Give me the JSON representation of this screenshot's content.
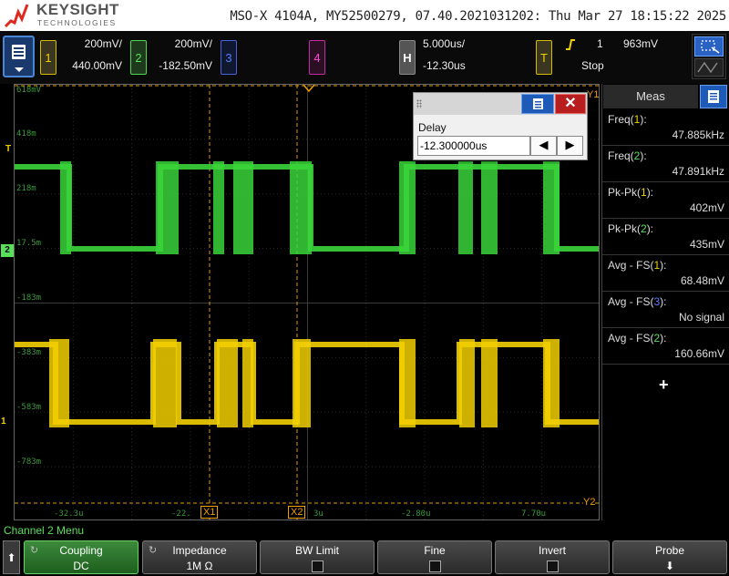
{
  "header": {
    "brand": "KEYSIGHT",
    "brand_sub": "TECHNOLOGIES",
    "title": "MSO-X 4104A, MY52500279, 07.40.2021031202: Thu Mar 27 18:15:22 2025"
  },
  "channels": [
    {
      "num": "1",
      "scale": "200mV/",
      "offset": "440.00mV",
      "color": "#f2d000"
    },
    {
      "num": "2",
      "scale": "200mV/",
      "offset": "-182.50mV",
      "color": "#58e058"
    },
    {
      "num": "3",
      "color": "#5b7cff"
    },
    {
      "num": "4",
      "color": "#ff4ad8"
    }
  ],
  "horizontal": {
    "tag": "H",
    "timebase": "5.000us/",
    "delay": "-12.30us"
  },
  "trigger": {
    "tag": "T",
    "edge_icon": "rising-edge-icon",
    "source": "1",
    "level": "963mV",
    "status": "Stop"
  },
  "graticule": {
    "y_labels": [
      "618mV",
      "418m",
      "218m",
      "17.5m",
      "-183m",
      "-383m",
      "-583m",
      "-783m"
    ],
    "x_labels": [
      "-32.3u",
      "-22.",
      "3u",
      "-2.80u",
      "7.70u"
    ],
    "markers": {
      "trigger_left": "T",
      "ch2": "2",
      "ch1": "1",
      "cursor_x1": "X1",
      "cursor_x2": "X2",
      "cursor_y1": "Y1",
      "cursor_y2": "Y2"
    }
  },
  "delay_popup": {
    "label": "Delay",
    "value": "-12.300000us",
    "close": "✕",
    "left": "◀",
    "right": "▶"
  },
  "meas": {
    "tab": "Meas",
    "items": [
      {
        "name": "Freq(",
        "ch": "1",
        "value": "47.885kHz",
        "cls": "c1"
      },
      {
        "name": "Freq(",
        "ch": "2",
        "value": "47.891kHz",
        "cls": "c2"
      },
      {
        "name": "Pk-Pk(",
        "ch": "1",
        "value": "402mV",
        "cls": "c1"
      },
      {
        "name": "Pk-Pk(",
        "ch": "2",
        "value": "435mV",
        "cls": "c2"
      },
      {
        "name": "Avg - FS(",
        "ch": "1",
        "value": "68.48mV",
        "cls": "c1"
      },
      {
        "name": "Avg - FS(",
        "ch": "3",
        "value": "No signal",
        "cls": "c3"
      },
      {
        "name": "Avg - FS(",
        "ch": "2",
        "value": "160.66mV",
        "cls": "c2"
      }
    ],
    "add": "+"
  },
  "menu": {
    "title": "Channel 2 Menu",
    "back": "⬆",
    "softkeys": [
      {
        "label": "Coupling",
        "value": "DC",
        "active": true,
        "rotary": true
      },
      {
        "label": "Impedance",
        "value": "1M Ω",
        "active": false,
        "rotary": true
      },
      {
        "label": "BW Limit",
        "checkbox": true
      },
      {
        "label": "Fine",
        "checkbox": true
      },
      {
        "label": "Invert",
        "checkbox": true
      },
      {
        "label": "Probe",
        "arrow": "⬇"
      }
    ]
  }
}
